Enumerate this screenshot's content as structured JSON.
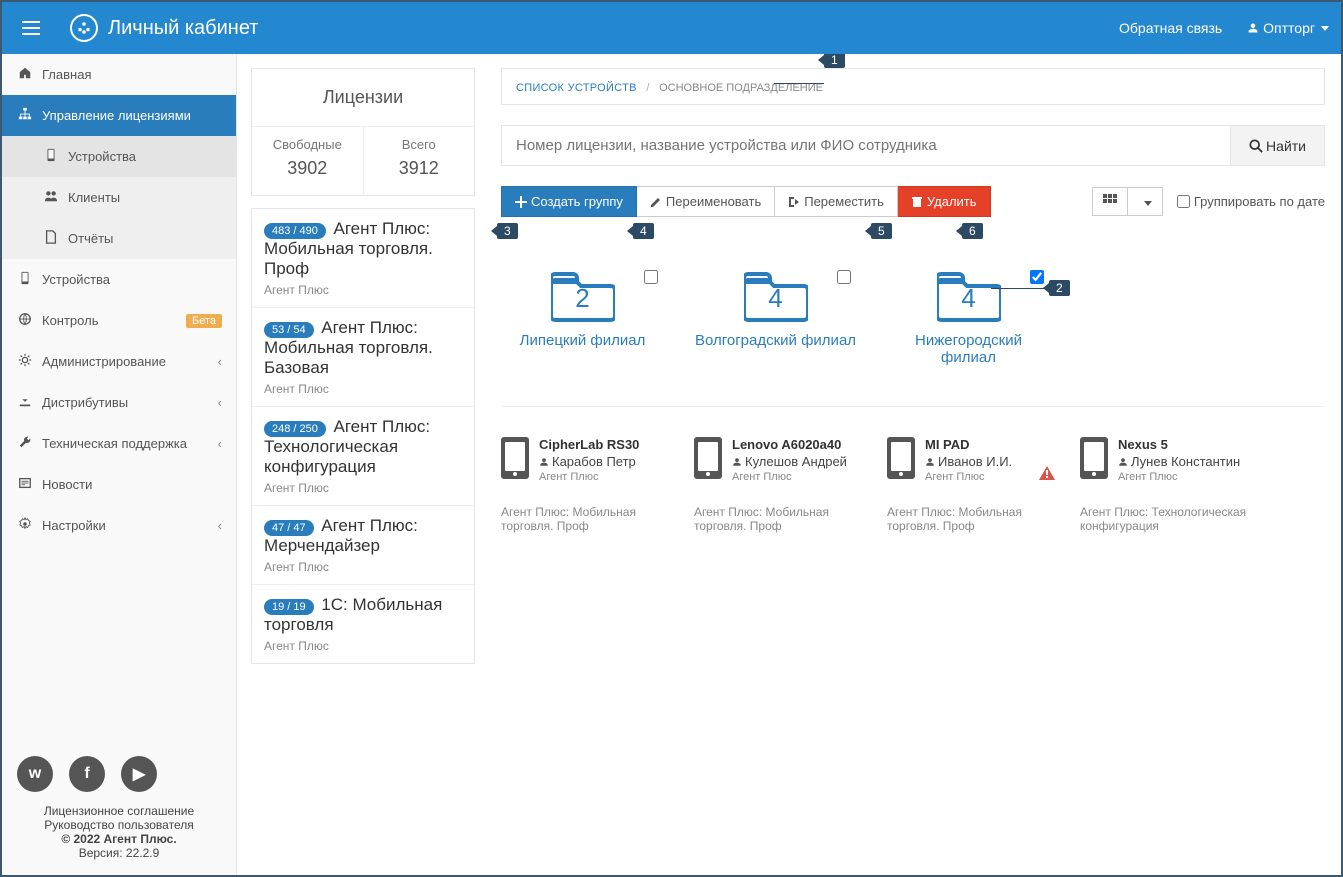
{
  "header": {
    "title": "Личный кабинет",
    "feedback": "Обратная связь",
    "user": "Оптторг"
  },
  "sidebar": {
    "items": [
      {
        "icon": "home",
        "label": "Главная"
      },
      {
        "icon": "sitemap",
        "label": "Управление лицензиями",
        "active": true
      },
      {
        "icon": "phone",
        "label": "Устройства"
      },
      {
        "icon": "globe",
        "label": "Контроль",
        "badge": "Бета"
      },
      {
        "icon": "cogs",
        "label": "Администрирование",
        "chev": true
      },
      {
        "icon": "download",
        "label": "Дистрибутивы",
        "chev": true
      },
      {
        "icon": "wrench",
        "label": "Техническая поддержка",
        "chev": true
      },
      {
        "icon": "news",
        "label": "Новости"
      },
      {
        "icon": "gear",
        "label": "Настройки",
        "chev": true
      }
    ],
    "sub": [
      {
        "icon": "phone",
        "label": "Устройства",
        "current": true
      },
      {
        "icon": "users",
        "label": "Клиенты"
      },
      {
        "icon": "file",
        "label": "Отчёты"
      }
    ],
    "footer": {
      "license": "Лицензионное соглашение",
      "manual": "Руководство пользователя",
      "copyright": "© 2022 Агент Плюс.",
      "version": "Версия: 22.2.9"
    }
  },
  "licenses": {
    "title": "Лицензии",
    "free_label": "Свободные",
    "free_value": "3902",
    "total_label": "Всего",
    "total_value": "3912",
    "items": [
      {
        "badge": "483 / 490",
        "name": "Агент Плюс: Мобильная торговля. Проф",
        "vendor": "Агент Плюс"
      },
      {
        "badge": "53 / 54",
        "name": "Агент Плюс: Мобильная торговля. Базовая",
        "vendor": "Агент Плюс"
      },
      {
        "badge": "248 / 250",
        "name": "Агент Плюс: Технологическая конфигурация",
        "vendor": "Агент Плюс"
      },
      {
        "badge": "47 / 47",
        "name": "Агент Плюс: Мерчендайзер",
        "vendor": "Агент Плюс"
      },
      {
        "badge": "19 / 19",
        "name": "1С: Мобильная торговля",
        "vendor": "Агент Плюс"
      }
    ]
  },
  "breadcrumb": {
    "root": "СПИСОК УСТРОЙСТВ",
    "current": "ОСНОВНОЕ ПОДРАЗДЕЛЕНИЕ"
  },
  "search": {
    "placeholder": "Номер лицензии, название устройства или ФИО сотрудника",
    "btn": "Найти"
  },
  "toolbar": {
    "create": "Создать группу",
    "rename": "Переименовать",
    "move": "Переместить",
    "delete": "Удалить",
    "group_by_date": "Группировать по дате"
  },
  "folders": [
    {
      "count": "2",
      "name": "Липецкий филиал",
      "checked": false
    },
    {
      "count": "4",
      "name": "Волгоградский филиал",
      "checked": false
    },
    {
      "count": "4",
      "name": "Нижегородский филиал",
      "checked": true
    }
  ],
  "devices": [
    {
      "name": "CipherLab RS30",
      "user": "Карабов Петр",
      "vendor": "Агент Плюс",
      "app": "Агент Плюс: Мобильная торговля. Проф",
      "warn": false
    },
    {
      "name": "Lenovo A6020a40",
      "user": "Кулешов Андрей",
      "vendor": "Агент Плюс",
      "app": "Агент Плюс: Мобильная торговля. Проф",
      "warn": false
    },
    {
      "name": "MI PAD",
      "user": "Иванов И.И.",
      "vendor": "Агент Плюс",
      "app": "Агент Плюс: Мобильная торговля. Проф",
      "warn": true
    },
    {
      "name": "Nexus 5",
      "user": "Лунев Константин",
      "vendor": "Агент Плюс",
      "app": "Агент Плюс: Технологическая конфигурация",
      "warn": false
    }
  ],
  "callouts": {
    "1": "1",
    "2": "2",
    "3": "3",
    "4": "4",
    "5": "5",
    "6": "6"
  }
}
